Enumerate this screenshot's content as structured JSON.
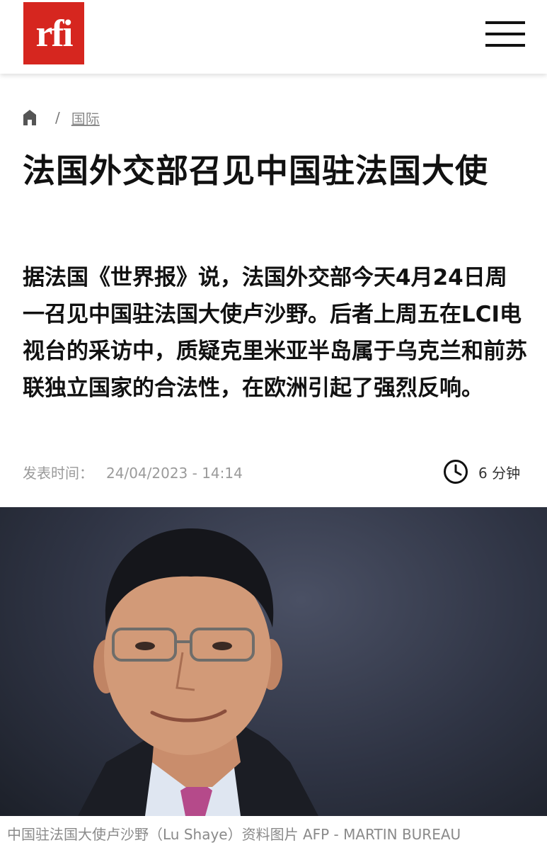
{
  "header": {
    "logo_text": "rfi",
    "brand_color": "#d6261f",
    "menu_icon": "hamburger-menu-icon"
  },
  "breadcrumb": {
    "home_icon": "home-icon",
    "separator": "/",
    "section": "国际"
  },
  "article": {
    "title": "法国外交部召见中国驻法国大使",
    "lead": "据法国《世界报》说，法国外交部今天4月24日周一召见中国驻法国大使卢沙野。后者上周五在LCI电视台的采访中，质疑克里米亚半岛属于乌克兰和前苏联独立国家的合法性，在欧洲引起了强烈反响。",
    "published_label": "发表时间：",
    "published_date": "24/04/2023 - 14:14",
    "read_time": "6 分钟",
    "read_time_icon": "clock-icon"
  },
  "image": {
    "caption": "中国驻法国大使卢沙野（Lu Shaye）资料图片  AFP - MARTIN BUREAU"
  }
}
